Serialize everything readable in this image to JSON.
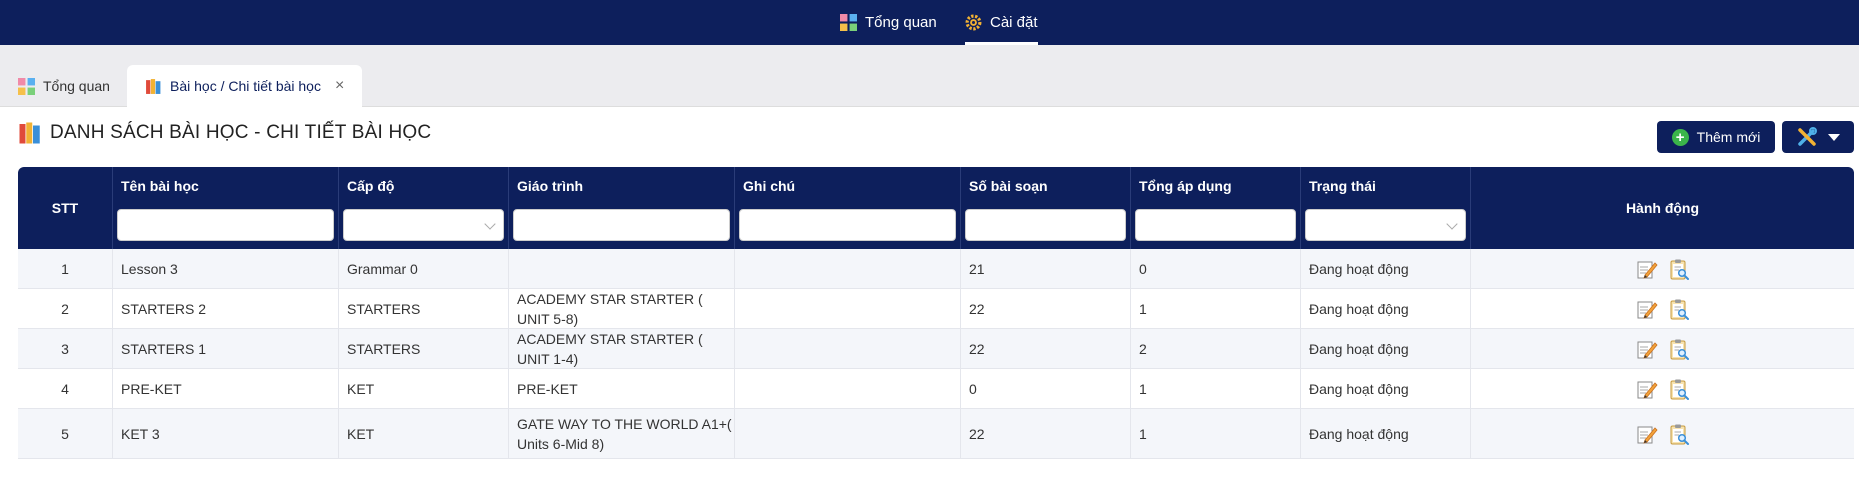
{
  "topnav": {
    "items": [
      {
        "label": "Tổng quan",
        "icon": "dashboard-grid-icon"
      },
      {
        "label": "Cài đặt",
        "icon": "gear-icon",
        "active": true
      }
    ]
  },
  "tabs": [
    {
      "label": "Tổng quan",
      "icon": "dashboard-grid-icon"
    },
    {
      "label": "Bài học / Chi tiết bài học",
      "icon": "books-icon",
      "active": true,
      "close": "×"
    }
  ],
  "page": {
    "title": "DANH SÁCH BÀI HỌC - CHI TIẾT BÀI HỌC",
    "add_label": "Thêm mới"
  },
  "table": {
    "headers": {
      "stt": "STT",
      "name": "Tên bài học",
      "level": "Cấp độ",
      "curriculum": "Giáo trình",
      "note": "Ghi chú",
      "lessons": "Số bài soạn",
      "applied": "Tổng áp dụng",
      "status": "Trạng thái",
      "actions": "Hành động"
    },
    "rows": [
      {
        "stt": "1",
        "name": "Lesson 3",
        "level": "Grammar 0",
        "curriculum": "",
        "note": "",
        "lessons": "21",
        "applied": "0",
        "status": "Đang hoạt động"
      },
      {
        "stt": "2",
        "name": "STARTERS 2",
        "level": "STARTERS",
        "curriculum": "ACADEMY STAR STARTER ( UNIT 5-8)",
        "note": "",
        "lessons": "22",
        "applied": "1",
        "status": "Đang hoạt động"
      },
      {
        "stt": "3",
        "name": "STARTERS 1",
        "level": "STARTERS",
        "curriculum": "ACADEMY STAR STARTER ( UNIT 1-4)",
        "note": "",
        "lessons": "22",
        "applied": "2",
        "status": "Đang hoạt động"
      },
      {
        "stt": "4",
        "name": "PRE-KET",
        "level": "KET",
        "curriculum": "PRE-KET",
        "note": "",
        "lessons": "0",
        "applied": "1",
        "status": "Đang hoạt động"
      },
      {
        "stt": "5",
        "name": "KET 3",
        "level": "KET",
        "curriculum": "GATE WAY TO THE WORLD A1+( Units 6-Mid 8)",
        "note": "",
        "lessons": "22",
        "applied": "1",
        "status": "Đang hoạt động"
      }
    ]
  },
  "colors": {
    "navy": "#0d1f5c",
    "green": "#3bb54a"
  }
}
